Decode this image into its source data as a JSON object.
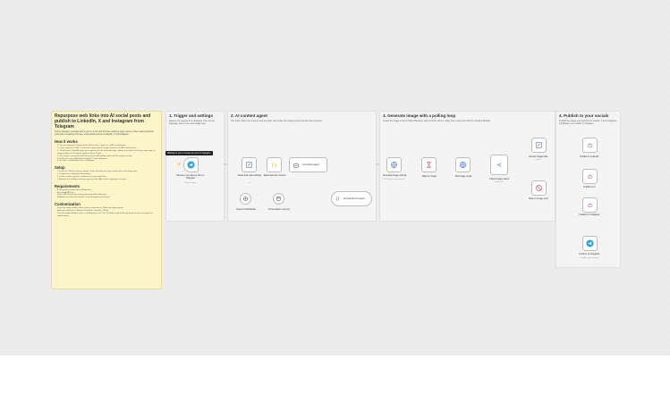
{
  "sticky": {
    "title": "Repurpose web links into AI social posts and publish to LinkedIn, X and Instagram from Telegram",
    "intro": "Send a Telegram message with a topic or a link, and this flow reads the page content, writes ready-to-publish posts with a matching AI image, and publishes them to LinkedIn, X and Instagram.",
    "how_title": "How it works",
    "how_steps": [
      "1. You message your Telegram bot with an idea, a topic, or a URL to repurpose.",
      "2. If your input has a URL, a web fetch step grabs the page content so the AI can build on it.",
      "3. The AI agent (OpenAI) reads your request plus the extracted page content and writes four things: post copy, an image prompt, an Instagram caption and an X post.",
      "4. The image is generated with Kie.ai, and a polling loop waits until the image is ready.",
      "5. Final posts are published to LinkedIn, X and Instagram.",
      "6. You get a confirmation back in Telegram."
    ],
    "setup_title": "Setup",
    "setup_steps": [
      "1. Open the \"Read and map settings\" node and add your page, brand voice and image style.",
      "2. Connect the credentials listed below.",
      "3. In Kie.ai node, put your connected account from Kie.ai.",
      "4. Activate the workflow and message your bot. Add a link to repurpose content!"
    ],
    "req_title": "Requirements",
    "req_items": [
      "A Telegram bot token from @BotFather",
      "An OpenAI API key",
      "A Kie.ai API key for the image generation (Nano Banana)",
      "A Blotato account with LinkedIn, X and Instagram connected"
    ],
    "custom_title": "Customization",
    "custom_items": [
      "Swap the image model, aspect ratio or resolution in \"Read and map settings\".",
      "Add more platforms in Blotato (Facebook, Threads, TikTok).",
      "The link reader handles articles and blog posts well. For YouTube, point at the key points in your message; the model adapts."
    ]
  },
  "sections": [
    {
      "title": "1. Trigger and settings",
      "sub": "Receive the request from Telegram, then set the language, brand voice and image style."
    },
    {
      "title": "2. AI content agent",
      "sub": "The brain reads your request (and any link), then writes the image prompt and the three captions."
    },
    {
      "title": "3. Generate image with a polling loop",
      "sub": "Create the image in Kie.ai (Nano Banana), wait and poll until it is ready, then extract the URL for upload to Blotato."
    },
    {
      "title": "4. Publish to your socials",
      "sub": "Publish the image and captions to LinkedIn, X and Instagram via Blotato, then confirm in Telegram."
    }
  ],
  "tooltip": "Waiting for you to create an event in Telegram",
  "nodes": {
    "trigger": {
      "label": "Receive your idea or link on Telegram",
      "sub": "Telegram trigger"
    },
    "settings": {
      "label": "Read and map settings",
      "sub": "set"
    },
    "fetch": {
      "label": "Read web link content",
      "sub": ""
    },
    "agent": {
      "label": "AI content agent"
    },
    "model": {
      "label": "OpenAI Chat Model"
    },
    "memory": {
      "label": "Conversation memory"
    },
    "format": {
      "label": "Format the AI output"
    },
    "create_image": {
      "label": "Generate image (Kie.ai)",
      "sub": "POST: https://api.kie.ai/api/v1/..."
    },
    "wait": {
      "label": "Wait for image"
    },
    "poll": {
      "label": "Poll image result"
    },
    "check": {
      "label": "Check image status",
      "sub": "routing rules"
    },
    "extract": {
      "label": "Extract image URL",
      "sub": "extract"
    },
    "stop": {
      "label": "Stop on image error"
    },
    "linkedin": {
      "label": "Publish to LinkedIn"
    },
    "x": {
      "label": "Publish to X"
    },
    "instagram": {
      "label": "Publish to Instagram"
    },
    "confirm": {
      "label": "Confirm on Telegram",
      "sub": "sendMessage: message"
    }
  }
}
